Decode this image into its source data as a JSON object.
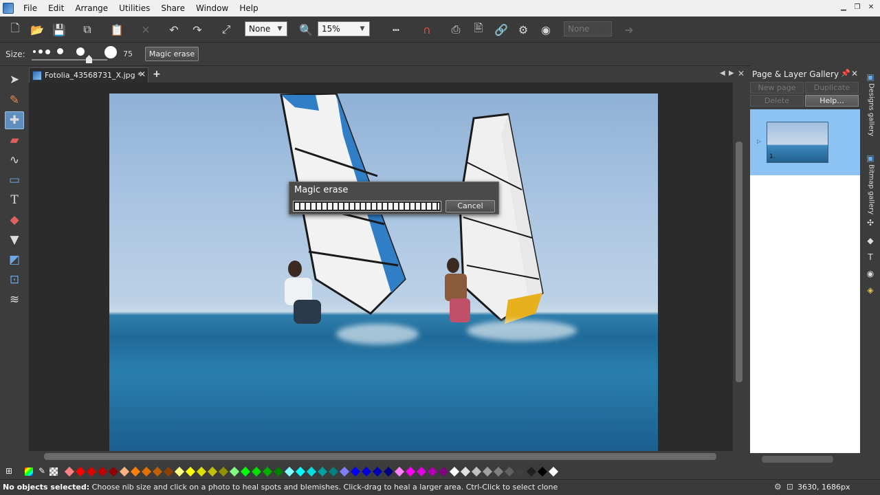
{
  "menubar": {
    "items": [
      "File",
      "Edit",
      "Arrange",
      "Utilities",
      "Share",
      "Window",
      "Help"
    ]
  },
  "toolbar": {
    "feather_value": "None",
    "zoom_value": "15%",
    "disabled_combo": "None"
  },
  "infobar": {
    "size_label": "Size:",
    "size_value": "75",
    "magic_erase_label": "Magic erase"
  },
  "document": {
    "tab_label": "Fotolia_43568731_X.jpg *"
  },
  "dialog": {
    "title": "Magic erase",
    "cancel_label": "Cancel",
    "progress_percent": 100
  },
  "panel": {
    "title": "Page & Layer Gallery",
    "buttons": [
      "New page",
      "Duplicate",
      "Delete",
      "Help..."
    ],
    "page_number": "1."
  },
  "side_tabs": {
    "designs": "Designs gallery",
    "bitmap": "Bitmap gallery"
  },
  "status": {
    "bold": "No objects selected:",
    "message": "Choose nib size and click on a photo to heal spots and blemishes. Click-drag to heal a larger area. Ctrl-Click to select clone",
    "coords": "3630, 1686px"
  },
  "colors": {
    "selection": "#8cc3f2",
    "accent": "#5e8fbf"
  },
  "palette": [
    "#ff8080",
    "#ff0000",
    "#e00000",
    "#c00000",
    "#900000",
    "#ffb080",
    "#ff8000",
    "#e07000",
    "#c06000",
    "#904000",
    "#ffff80",
    "#ffff00",
    "#e0e000",
    "#c0c000",
    "#909000",
    "#80ff80",
    "#00ff00",
    "#00e000",
    "#00b000",
    "#008000",
    "#80ffff",
    "#00ffff",
    "#00e0e0",
    "#00a0a0",
    "#008080",
    "#8080ff",
    "#0000ff",
    "#0000e0",
    "#0000b0",
    "#000080",
    "#ff80ff",
    "#ff00ff",
    "#e000e0",
    "#b000b0",
    "#800080",
    "#ffffff",
    "#e0e0e0",
    "#c0c0c0",
    "#a0a0a0",
    "#808080",
    "#606060",
    "#404040",
    "#202020",
    "#000000",
    "#ffffff"
  ]
}
